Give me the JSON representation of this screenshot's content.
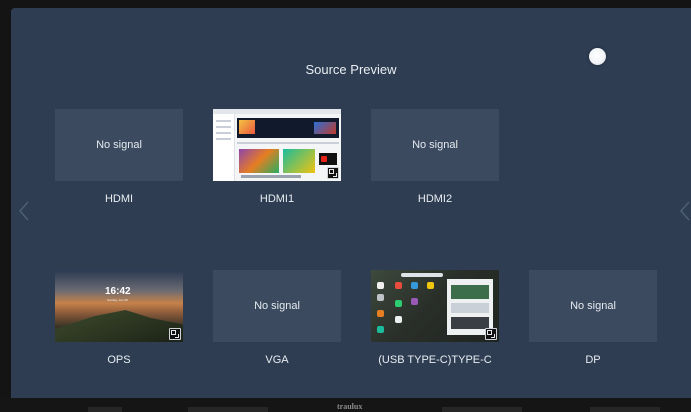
{
  "screen": {
    "title": "Source Preview",
    "background": "#2e3d52",
    "tile_background": "#3b4a5f"
  },
  "sources": [
    {
      "label": "HDMI",
      "status": "No signal"
    },
    {
      "label": "HDMI1",
      "preview": "browser-screenshot"
    },
    {
      "label": "HDMI2",
      "status": "No signal"
    },
    {
      "label": "OPS",
      "preview": "lock-screen",
      "clock": "16:42",
      "date": "Sunday, Jan 28"
    },
    {
      "label": "VGA",
      "status": "No signal"
    },
    {
      "label": "(USB TYPE-C)TYPE-C",
      "preview": "desktop-screenshot"
    },
    {
      "label": "DP",
      "status": "No signal"
    }
  ],
  "icons": {
    "prev": "chevron-left-icon",
    "next": "chevron-right-icon",
    "expand": "expand-icon",
    "toggle": "toggle-dot"
  },
  "bezel": {
    "brand": "traulux"
  }
}
